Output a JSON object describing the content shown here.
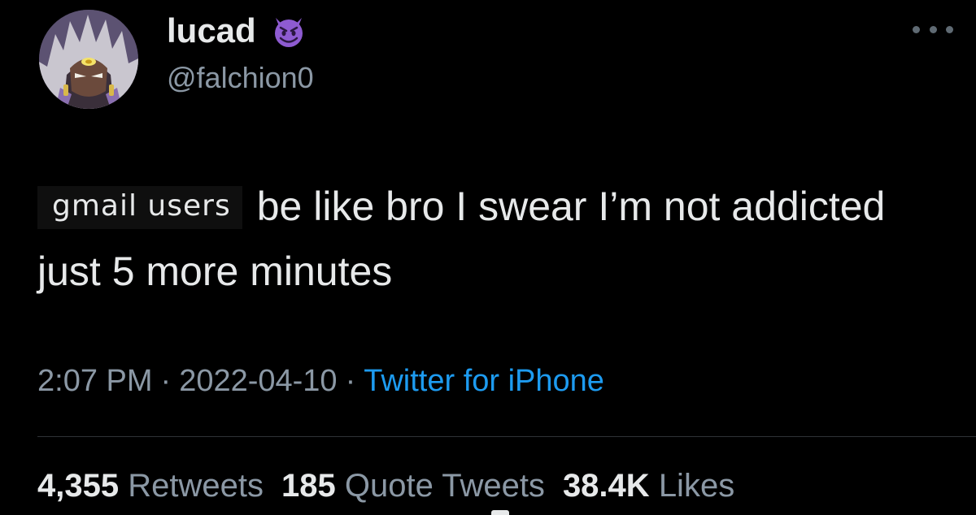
{
  "user": {
    "display_name": "lucad",
    "handle": "@falchion0",
    "name_emoji": "smiling-imp-emoji"
  },
  "tweet": {
    "image_snippet_text": "gmail users",
    "text": "be like bro I swear I’m not addicted just 5 more minutes"
  },
  "meta": {
    "time": "2:07 PM",
    "separator": "·",
    "date": "2022-04-10",
    "source": "Twitter for iPhone"
  },
  "stats": {
    "retweets_count": "4,355",
    "retweets_label": "Retweets",
    "quotes_count": "185",
    "quotes_label": "Quote Tweets",
    "likes_count": "38.4K",
    "likes_label": "Likes"
  },
  "colors": {
    "background": "#000000",
    "text_primary": "#e7e9ea",
    "text_secondary": "#8b98a5",
    "link_blue": "#1d9bf0",
    "emoji_purple": "#8e5bd1"
  }
}
